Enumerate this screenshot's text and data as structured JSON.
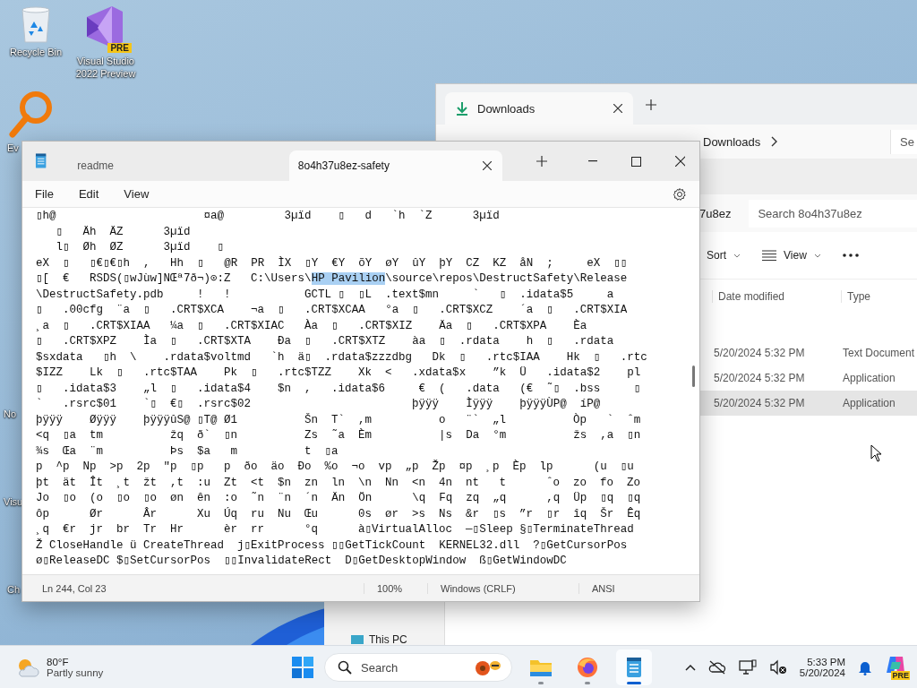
{
  "desktop": {
    "icons": [
      {
        "kind": "recycle",
        "label": "Recycle Bin"
      },
      {
        "kind": "vs",
        "label": "Visual Studio 2022 Preview",
        "badge": "PRE"
      },
      {
        "kind": "magnifier",
        "label": "Ev"
      },
      {
        "kind": "partial",
        "label": "No"
      },
      {
        "kind": "partial",
        "label": "Visu"
      },
      {
        "kind": "partial",
        "label": "Ch"
      }
    ]
  },
  "explorer": {
    "tab": "Downloads",
    "breadcrumb": "Downloads",
    "search_cut": "Se",
    "path_tail": "7u8ez",
    "search_placeholder": "Search 8o4h37u8ez",
    "toolbar": [
      "Sort",
      "View"
    ],
    "columns": [
      "Date modified",
      "Type"
    ],
    "rows": [
      {
        "date": "5/20/2024 5:32 PM",
        "type": "Text Document",
        "selected": false
      },
      {
        "date": "5/20/2024 5:32 PM",
        "type": "Application",
        "selected": false
      },
      {
        "date": "5/20/2024 5:32 PM",
        "type": "Application",
        "selected": true
      }
    ],
    "nav_item": "This PC"
  },
  "notepad": {
    "tabs": [
      {
        "label": "readme",
        "selected": false
      },
      {
        "label": "8o4h37u8ez-safety",
        "selected": true
      }
    ],
    "menu": [
      "File",
      "Edit",
      "View"
    ],
    "lines": [
      "▯h@                      ¤a@         3µïd    ▯   d   `h  `Z      3µïd",
      "   ▯   Äh  ÄZ      3µïd",
      "   l▯  Øh  ØZ      3µïd    ▯",
      "eX  ▯   ▯€▯€▯h  ,   Hh  ▯   @R  PR  ÌX  ▯Y  €Y  õY  øY  ûY  þY  CZ  KZ  åN  ;     eX  ▯▯",
      [
        {
          "text": "▯[  €   RSDS(▯wJùw]NŒª7ð¬)⊙:Z   C:\\Users\\",
          "selected": false
        },
        {
          "text": "HP Pavilion",
          "selected": true
        },
        {
          "text": "\\source\\repos\\DestructSafety\\Release",
          "selected": false
        }
      ],
      "\\DestructSafety.pdb     !   !           GCTL ▯  ▯L  .text$mn     `   ▯  .idata$5     a",
      "▯   .00cfg  ¨a  ▯   .CRT$XCA    ¬a  ▯   .CRT$XCAA   °a  ▯   .CRT$XCZ    ´a  ▯   .CRT$XIA",
      "¸a  ▯   .CRT$XIAA   ¼a  ▯   .CRT$XIAC   Àa  ▯   .CRT$XIZ    Äa  ▯   .CRT$XPA    Èa",
      "▯   .CRT$XPZ    Ìa  ▯   .CRT$XTA    Ða  ▯   .CRT$XTZ    àa  ▯  .rdata    h  ▯   .rdata",
      "$sxdata   ▯h  \\    .rdata$voltmd   `h  ä▯  .rdata$zzzdbg   Dk  ▯   .rtc$IAA    Hk  ▯   .rtc",
      "$IZZ    Lk  ▯   .rtc$TAA    Pk  ▯   .rtc$TZZ    Xk  <   .xdata$x    ”k  Ü   .idata$2    pl",
      "▯   .idata$3    „l  ▯   .idata$4    $n  ,   .idata$6     €  (   .data   (€  ˜▯  .bss     ▯",
      "`   .rsrc$01    `▯  €▯  .rsrc$02                        þÿÿÿ    Ìÿÿÿ    þÿÿÿÙP@  íP@",
      "þÿÿÿ    Øÿÿÿ    þÿÿÿûS@ ▯T@ Ø1          Šn  T`  ,m          o   ¨`  „l          Òp   `  ˆm",
      "<q  ▯a  tm          žq  ð`  ▯n          Zs  ˜a  Èm          |s  Da  °m          žs  ,a  ▯n",
      "¾s  Œa  ¨m          Þs  $a   m          t  ▯a",
      "p  ^p  Np  >p  2p  \"p  ▯p   p  ðo  äo  Ðo  %o  ¬o  vp  „p  Žp  ¤p  ¸p  Èp  lp      (u  ▯u",
      "þt  ät  Ît  ¸t  žt  ,t  :u  Zt  <t  $n  zn  ln  \\n  Nn  <n  4n  nt   t      ˆo  zo  fo  Zo",
      "Jo  ▯o  (o  ▯o  ▯o  øn  ên  :o  ˜n  ¨n  ´n  Än  Ön      \\q  Fq  zq  „q      ,q  Üp  ▯q  ▯q",
      "ôp      Ør      Âr      Xu  Úq  ru  Nu  Œu      0s  ør  >s  Ns  &r  ▯s  ”r  ▯r  îq  Šr  Êq",
      "¸q  €r  jr  br  Tr  Hr      èr  rr      °q      à▯VirtualAlloc  —▯Sleep §▯TerminateThread",
      "Ž CloseHandle ü CreateThread  j▯ExitProcess ▯▯GetTickCount  KERNEL32.dll  ?▯GetCursorPos",
      "ø▯ReleaseDC $▯SetCursorPos  ▯▯InvalidateRect  D▯GetDesktopWindow  ß▯GetWindowDC"
    ],
    "status": [
      "Ln 244, Col 23",
      "100%",
      "Windows (CRLF)",
      "ANSI"
    ]
  },
  "taskbar": {
    "weather": {
      "temp": "80°F",
      "condition": "Partly sunny"
    },
    "search_placeholder": "Search",
    "apps": [
      {
        "kind": "folder",
        "active": false
      },
      {
        "kind": "browser",
        "active": false
      },
      {
        "kind": "notepad",
        "active": true
      }
    ],
    "time": "5:33 PM",
    "date": "5/20/2024",
    "copilot_badge": "PRE"
  }
}
